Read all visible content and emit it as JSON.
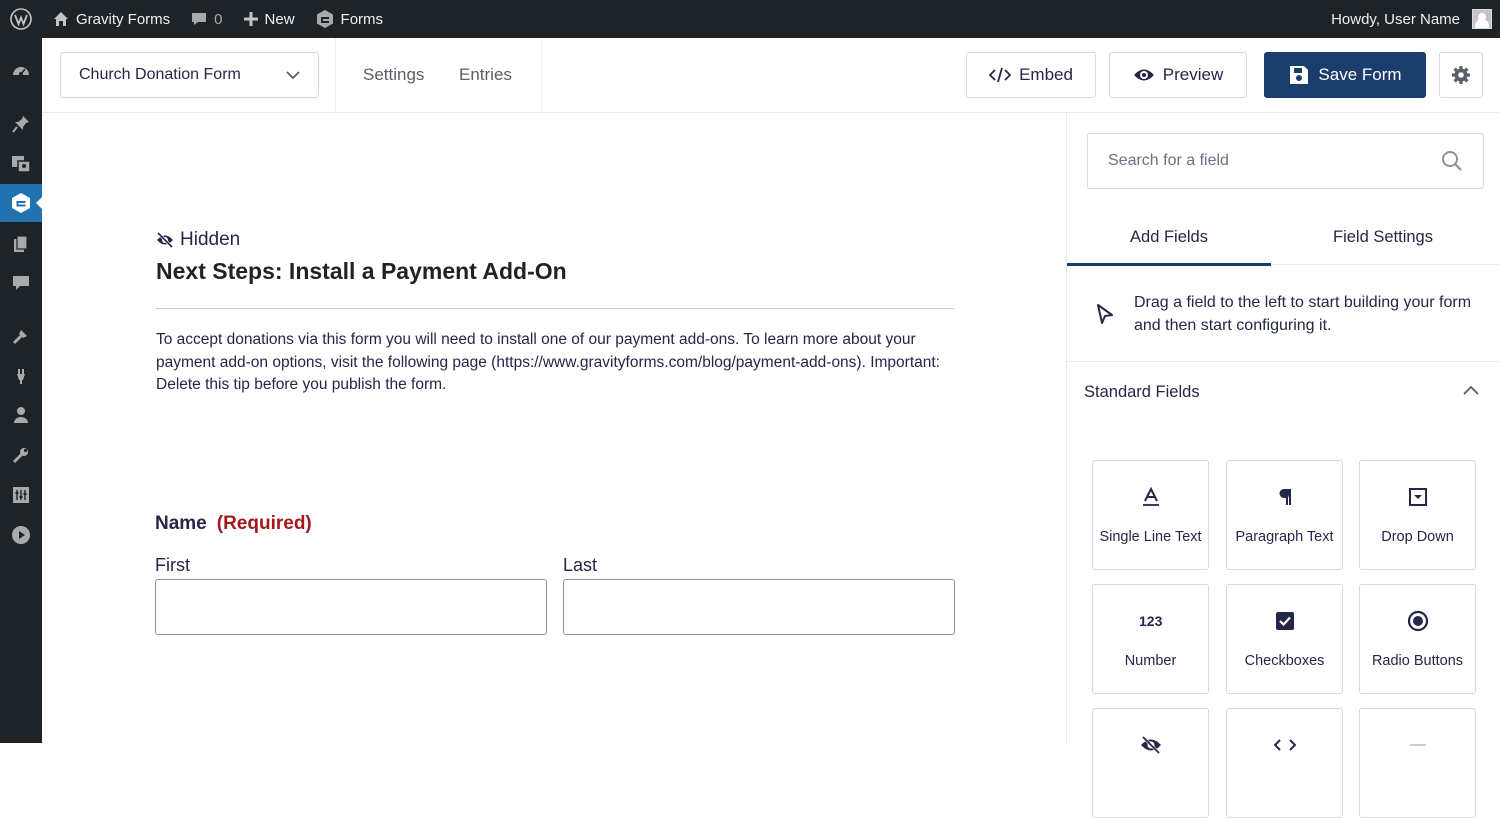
{
  "adminbar": {
    "site_name": "Gravity Forms",
    "comments_count": "0",
    "new_label": "New",
    "forms_label": "Forms",
    "howdy": "Howdy, User Name"
  },
  "sidebar_icons": [
    "dashboard-icon",
    "pin-icon",
    "media-icon",
    "gravity-forms-icon",
    "pages-icon",
    "comments-icon",
    "appearance-icon",
    "plugins-icon",
    "users-icon",
    "tools-icon",
    "settings-icon",
    "play-icon"
  ],
  "header": {
    "form_name": "Church Donation Form",
    "settings": "Settings",
    "entries": "Entries",
    "embed": "Embed",
    "preview": "Preview",
    "save": "Save Form"
  },
  "canvas": {
    "hidden_label": "Hidden",
    "section_title": "Next Steps: Install a Payment Add-On",
    "section_description": "To accept donations via this form you will need to install one of our payment add-ons. To learn more about your payment add-on options, visit the following page (https://www.gravityforms.com/blog/payment-add-ons). Important: Delete this tip before you publish the form.",
    "name_label": "Name",
    "required_label": "(Required)",
    "first_label": "First",
    "last_label": "Last"
  },
  "panel": {
    "search_placeholder": "Search for a field",
    "tab_add_fields": "Add Fields",
    "tab_field_settings": "Field Settings",
    "drag_hint": "Drag a field to the left to start building your form and then start configuring it.",
    "standard_fields_title": "Standard Fields",
    "fields": [
      {
        "label": "Single Line Text",
        "icon": "single-line-text-icon"
      },
      {
        "label": "Paragraph Text",
        "icon": "paragraph-icon"
      },
      {
        "label": "Drop Down",
        "icon": "dropdown-icon"
      },
      {
        "label": "Number",
        "icon": "number-icon"
      },
      {
        "label": "Checkboxes",
        "icon": "checkbox-icon"
      },
      {
        "label": "Radio Buttons",
        "icon": "radio-icon"
      }
    ]
  },
  "colors": {
    "wp_dark": "#1d2327",
    "wp_active": "#2271b1",
    "gf_primary": "#1b3d6d",
    "required": "#a4191e"
  }
}
